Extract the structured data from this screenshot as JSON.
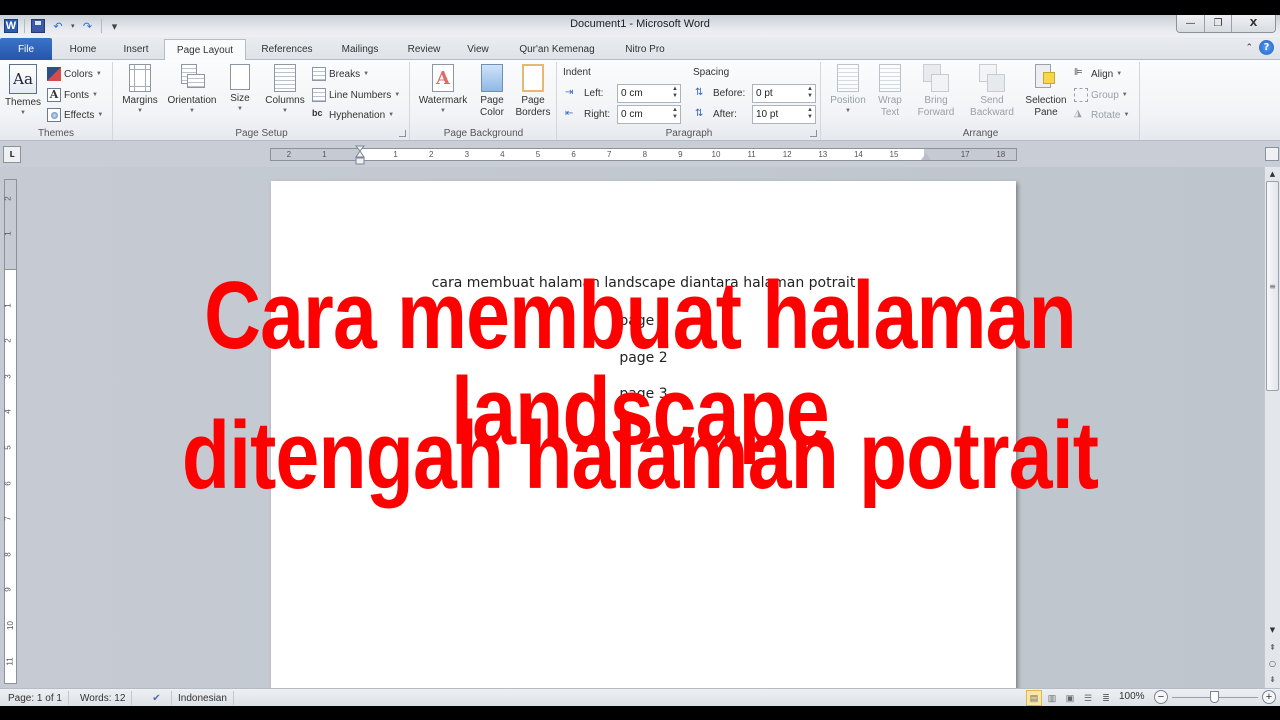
{
  "window": {
    "title": "Document1  -  Microsoft Word",
    "controls": {
      "minimize": "—",
      "restore": "❐",
      "close": "X"
    }
  },
  "qat": {
    "app_icon": "W",
    "save_icon": "save-icon",
    "undo_icon": "↶",
    "redo_icon": "↷",
    "customize_icon": "▾"
  },
  "tabs": [
    {
      "label": "File"
    },
    {
      "label": "Home"
    },
    {
      "label": "Insert"
    },
    {
      "label": "Page Layout",
      "active": true
    },
    {
      "label": "References"
    },
    {
      "label": "Mailings"
    },
    {
      "label": "Review"
    },
    {
      "label": "View"
    },
    {
      "label": "Qur'an Kemenag"
    },
    {
      "label": "Nitro Pro"
    }
  ],
  "tab_right": {
    "minimize_ribbon": "⌃",
    "help": "?"
  },
  "ribbon": {
    "themes": {
      "label": "Themes",
      "themes_btn": "Themes",
      "colors": "Colors",
      "fonts": "Fonts",
      "effects": "Effects"
    },
    "page_setup": {
      "label": "Page Setup",
      "margins": "Margins",
      "orientation": "Orientation",
      "size": "Size",
      "columns": "Columns",
      "breaks": "Breaks",
      "line_numbers": "Line Numbers",
      "hyphenation": "Hyphenation"
    },
    "page_background": {
      "label": "Page Background",
      "watermark": "Watermark",
      "page_color_1": "Page",
      "page_color_2": "Color",
      "page_borders_1": "Page",
      "page_borders_2": "Borders"
    },
    "paragraph": {
      "label": "Paragraph",
      "indent_header": "Indent",
      "spacing_header": "Spacing",
      "left_label": "Left:",
      "left_value": "0 cm",
      "right_label": "Right:",
      "right_value": "0 cm",
      "before_label": "Before:",
      "before_value": "0 pt",
      "after_label": "After:",
      "after_value": "10 pt"
    },
    "arrange": {
      "label": "Arrange",
      "position": "Position",
      "wrap_text_1": "Wrap",
      "wrap_text_2": "Text",
      "bring_forward_1": "Bring",
      "bring_forward_2": "Forward",
      "send_backward_1": "Send",
      "send_backward_2": "Backward",
      "selection_pane_1": "Selection",
      "selection_pane_2": "Pane",
      "align": "Align",
      "group": "Group",
      "rotate": "Rotate"
    }
  },
  "ruler": {
    "tab_selector": "L",
    "h_numbers": [
      "2",
      "1",
      "1",
      "2",
      "3",
      "4",
      "5",
      "6",
      "7",
      "8",
      "9",
      "10",
      "11",
      "12",
      "13",
      "14",
      "15",
      "17",
      "18"
    ],
    "v_numbers": [
      "2",
      "1",
      "1",
      "2",
      "3",
      "4",
      "5",
      "6",
      "7",
      "8",
      "9",
      "10",
      "11"
    ]
  },
  "document": {
    "lines": [
      "cara membuat halaman landscape diantara halaman potrait",
      "page 1",
      "page 2",
      "page 3"
    ]
  },
  "overlay": {
    "line1": "Cara membuat halaman landscape",
    "line2": "ditengah halaman potrait",
    "color": "#ff0000"
  },
  "statusbar": {
    "page": "Page: 1 of 1",
    "words": "Words: 12",
    "language": "Indonesian",
    "zoom": "100%",
    "zoom_level_percent": 100
  }
}
